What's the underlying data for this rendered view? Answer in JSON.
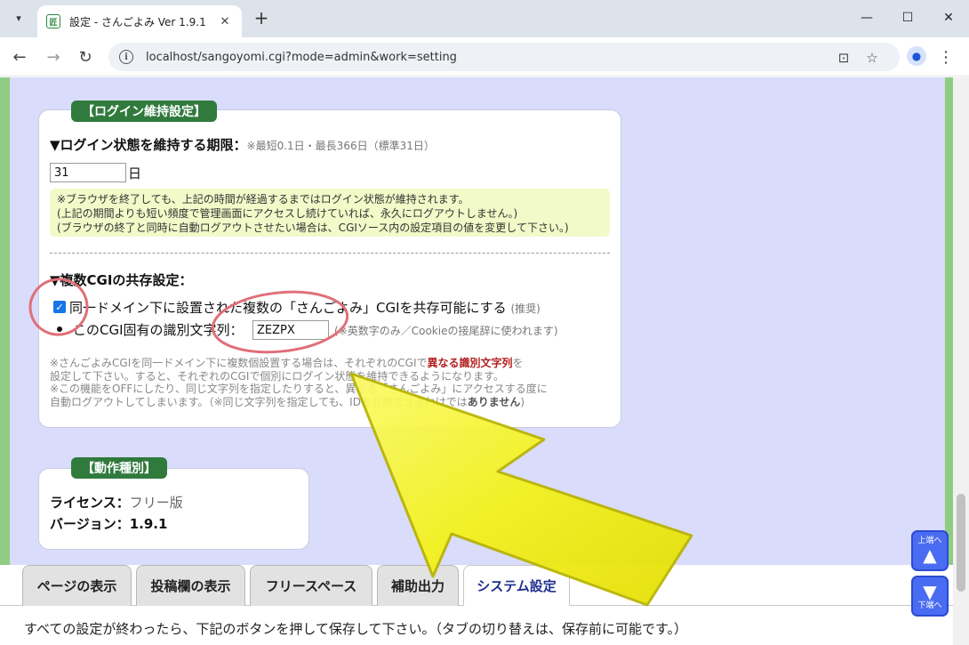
{
  "browser": {
    "tab_title": "設定 - さんごよみ Ver 1.9.1",
    "favicon_text": "匠",
    "url": "localhost/sangoyomi.cgi?mode=admin&work=setting",
    "icons": {
      "tab_menu": "chevron-down-icon",
      "close": "close-icon",
      "new_tab": "plus-icon",
      "back": "back-arrow-icon",
      "forward": "forward-arrow-icon",
      "reload": "reload-icon",
      "info": "info-icon",
      "lens": "lens-icon",
      "star": "star-icon",
      "profile": "profile-icon",
      "menu": "kebab-menu-icon"
    }
  },
  "login_section": {
    "legend": "【ログイン維持設定】",
    "heading": "▼ログイン状態を維持する期限：",
    "heading_note": "※最短0.1日・最長366日（標準31日）",
    "days_value": "31",
    "days_unit": "日",
    "info_lines": [
      "※ブラウザを終了しても、上記の時間が経過するまではログイン状態が維持されます。",
      "(上記の期間よりも短い頻度で管理画面にアクセスし続けていれば、永久にログアウトしません。)",
      "(ブラウザの終了と同時に自動ログアウトさせたい場合は、CGIソース内の設定項目の値を変更して下さい。)"
    ]
  },
  "cgi_section": {
    "heading": "▼複数CGIの共存設定：",
    "checkbox_checked": true,
    "checkbox_label": "同一ドメイン下に設置された複数の「さんごよみ」CGIを共存可能にする",
    "checkbox_note": "(推奨)",
    "id_label": "このCGI固有の識別文字列：",
    "id_value": "ZEZPX",
    "id_note": "(※英数字のみ／Cookieの接尾辞に使われます)",
    "note_line1_a": "※さんごよみCGIを同一ドメイン下に複数個設置する場合は、それぞれのCGIで",
    "note_line1_red": "異なる識別文字列",
    "note_line1_b": "を",
    "note_line2": "設定して下さい。すると、それぞれのCGIで個別にログイン状態を維持できるようになります。",
    "note_line3": "※この機能をOFFにしたり、同じ文字列を指定したりすると、異なる「さんごよみ」にアクセスする度に",
    "note_line4_a": "自動ログアウトしてしまいます。（※同じ文字列を指定しても、IDを共用できるわけでは",
    "note_line4_bold": "ありません",
    "note_line4_b": ")"
  },
  "op_section": {
    "legend": "【動作種別】",
    "license_label": "ライセンス：",
    "license_value": "フリー版",
    "version_label": "バージョン：",
    "version_value": "1.9.1"
  },
  "tabs": [
    {
      "label": "ページの表示",
      "active": false
    },
    {
      "label": "投稿欄の表示",
      "active": false
    },
    {
      "label": "フリースペース",
      "active": false
    },
    {
      "label": "補助出力",
      "active": false
    },
    {
      "label": "システム設定",
      "active": true
    }
  ],
  "footer_message": "すべての設定が終わったら、下記のボタンを押して保存して下さい。（タブの切り替えは、保存前に可能です。）",
  "jump_buttons": {
    "top_label": "上端へ",
    "top_icon": "triangle-up-icon",
    "bottom_label": "下端へ",
    "bottom_icon": "triangle-down-icon"
  },
  "annotation_colors": {
    "circle": "#e06f79",
    "arrow_fill": "#f4f218",
    "arrow_edge": "#b8b300"
  }
}
